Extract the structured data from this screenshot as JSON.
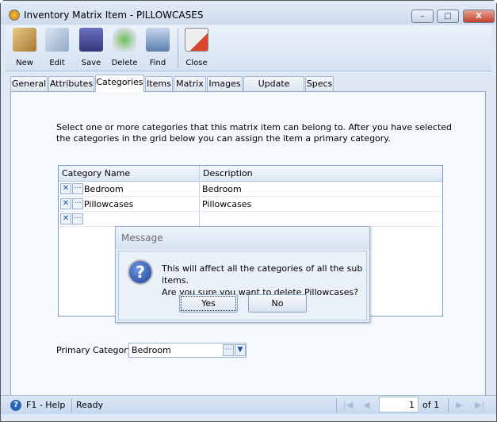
{
  "window": {
    "title": "Inventory Matrix Item - PILLOWCASES",
    "minimize": "–",
    "restore": "□",
    "close": "X"
  },
  "toolbar": {
    "buttons": [
      {
        "label": "New",
        "icon": "new-icon",
        "color": "#c9a25a"
      },
      {
        "label": "Edit",
        "icon": "edit-icon",
        "color": "#8fa8c8"
      },
      {
        "label": "Save",
        "icon": "save-icon",
        "color": "#4a4f9a"
      },
      {
        "label": "Delete",
        "icon": "recycle-bin-icon",
        "color": "#5aa84a"
      },
      {
        "label": "Find",
        "icon": "binoculars-icon",
        "color": "#5b7fae"
      },
      {
        "label": "Close",
        "icon": "close-form-icon",
        "color": "#d9472c"
      }
    ]
  },
  "tabs": [
    "General",
    "Attributes",
    "Categories",
    "Items",
    "Matrix",
    "Images",
    "Update Prices",
    "Specs"
  ],
  "active_tab": "Categories",
  "categories": {
    "intro": "Select one or more categories that this matrix item can belong to. After you have selected the categories in the grid below you can assign the item a primary category.",
    "columns": [
      "Category Name",
      "Description"
    ],
    "rows": [
      {
        "name": "Bedroom",
        "description": "Bedroom"
      },
      {
        "name": "Pillowcases",
        "description": "Pillowcases"
      },
      {
        "name": "",
        "description": ""
      }
    ],
    "primary_label": "Primary Category",
    "primary_value": "Bedroom"
  },
  "dialog": {
    "title": "Message",
    "line1": "This will affect all the categories of all the sub items.",
    "line2": "Are you sure you want to delete Pillowcases?",
    "yes": "Yes",
    "no": "No"
  },
  "status": {
    "help": "F1 - Help",
    "text": "Ready",
    "page": "1",
    "of": "of 1"
  }
}
